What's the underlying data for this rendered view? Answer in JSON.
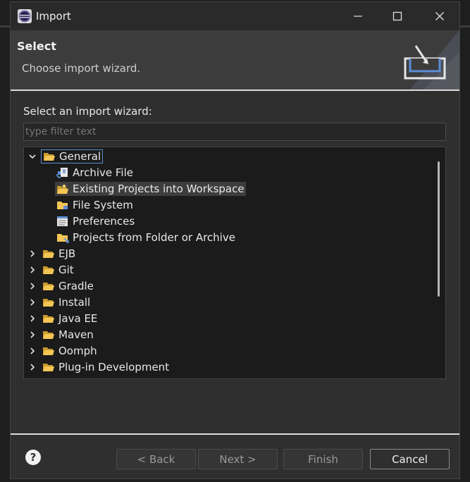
{
  "window": {
    "title": "Import"
  },
  "banner": {
    "title": "Select",
    "description": "Choose import wizard."
  },
  "wizard": {
    "prompt": "Select an import wizard:",
    "filter_placeholder": "type filter text"
  },
  "tree": {
    "items": [
      {
        "label": "General",
        "expanded": true,
        "level": 0,
        "selected": true
      },
      {
        "label": "Archive File",
        "level": 1
      },
      {
        "label": "Existing Projects into Workspace",
        "level": 1,
        "highlighted": true
      },
      {
        "label": "File System",
        "level": 1
      },
      {
        "label": "Preferences",
        "level": 1
      },
      {
        "label": "Projects from Folder or Archive",
        "level": 1
      },
      {
        "label": "EJB",
        "level": 0
      },
      {
        "label": "Git",
        "level": 0
      },
      {
        "label": "Gradle",
        "level": 0
      },
      {
        "label": "Install",
        "level": 0
      },
      {
        "label": "Java EE",
        "level": 0
      },
      {
        "label": "Maven",
        "level": 0
      },
      {
        "label": "Oomph",
        "level": 0
      },
      {
        "label": "Plug-in Development",
        "level": 0
      }
    ]
  },
  "buttons": {
    "back": "< Back",
    "next": "Next >",
    "finish": "Finish",
    "cancel": "Cancel"
  },
  "icons": {
    "app": "eclipse-icon",
    "minimize": "minimize-icon",
    "maximize": "maximize-icon",
    "close": "close-icon",
    "help": "help-icon",
    "folder": "folder-icon",
    "archive": "archive-file-icon",
    "preferences": "preferences-icon"
  },
  "colors": {
    "selection_border": "#5a8fd0",
    "folder": "#f0c14b",
    "background": "#2f2f2f"
  }
}
